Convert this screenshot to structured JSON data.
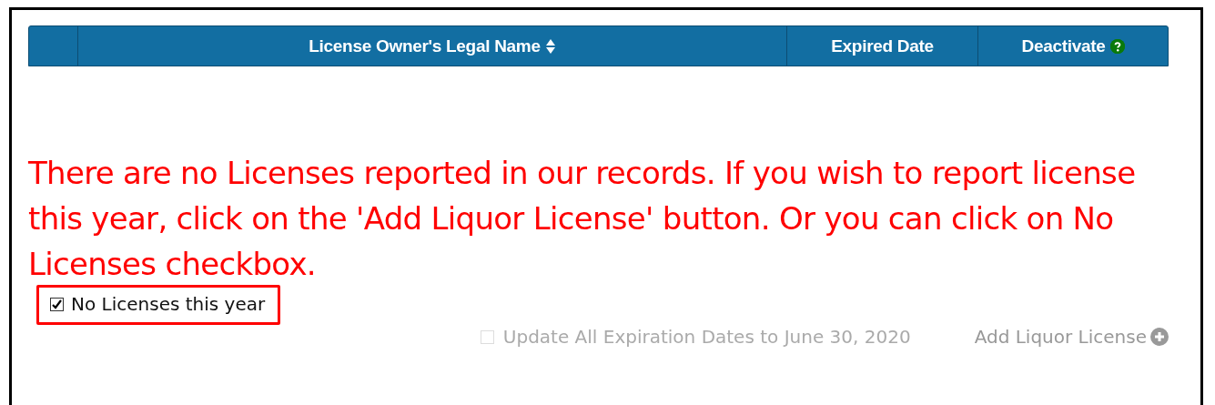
{
  "table": {
    "columns": [
      {
        "label": "License Owner's Legal Name",
        "sortable": true,
        "help": false
      },
      {
        "label": "Expired Date",
        "sortable": false,
        "help": false
      },
      {
        "label": "Deactivate",
        "sortable": false,
        "help": true
      }
    ]
  },
  "message": "There are no Licenses reported in our records. If you wish to report license this year, click on the 'Add Liquor License' button. Or you can click on No Licenses checkbox.",
  "no_licenses": {
    "label": "No Licenses this year",
    "checked": true,
    "highlighted": true
  },
  "update_all": {
    "label": "Update All Expiration Dates to June 30, 2020",
    "checked": false,
    "disabled": true
  },
  "add_button": {
    "label": "Add Liquor License",
    "disabled": true
  }
}
